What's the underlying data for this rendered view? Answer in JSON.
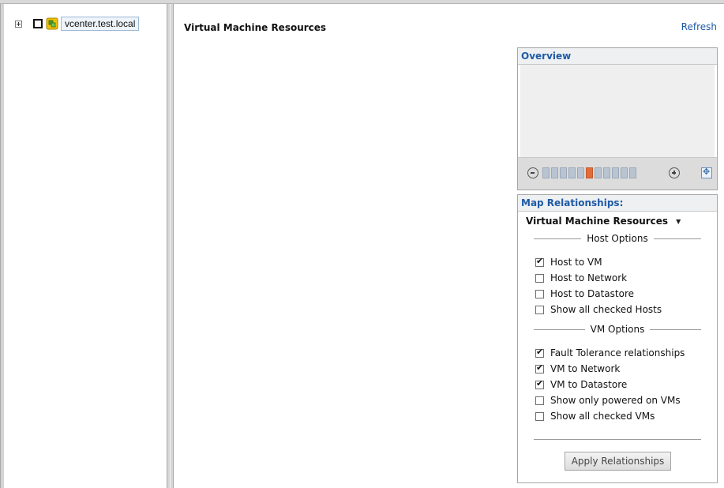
{
  "inventory_tree": {
    "root_label": "vcenter.test.local",
    "expander_icon": "plus-box-icon",
    "node_icon": "vcenter-server-icon"
  },
  "main": {
    "title": "Virtual Machine Resources",
    "refresh_label": "Refresh"
  },
  "overview": {
    "header": "Overview",
    "zoom_steps": 11,
    "zoom_active_step": 6
  },
  "map_relationships": {
    "header": "Map Relationships:",
    "selected_view": "Virtual Machine Resources",
    "host_options": {
      "heading": "Host Options",
      "items": [
        {
          "label": "Host to VM",
          "checked": true
        },
        {
          "label": "Host to Network",
          "checked": false
        },
        {
          "label": "Host to Datastore",
          "checked": false
        },
        {
          "label": "Show all checked Hosts",
          "checked": false
        }
      ]
    },
    "vm_options": {
      "heading": "VM Options",
      "items": [
        {
          "label": "Fault Tolerance relationships",
          "checked": true
        },
        {
          "label": "VM to Network",
          "checked": true
        },
        {
          "label": "VM to Datastore",
          "checked": true
        },
        {
          "label": "Show only powered on VMs",
          "checked": false
        },
        {
          "label": "Show all checked VMs",
          "checked": false
        }
      ]
    },
    "apply_label": "Apply Relationships"
  },
  "colors": {
    "link_blue": "#1f5aa6",
    "zoom_active": "#e06d3a",
    "zoom_inactive": "#b8c4d2"
  }
}
